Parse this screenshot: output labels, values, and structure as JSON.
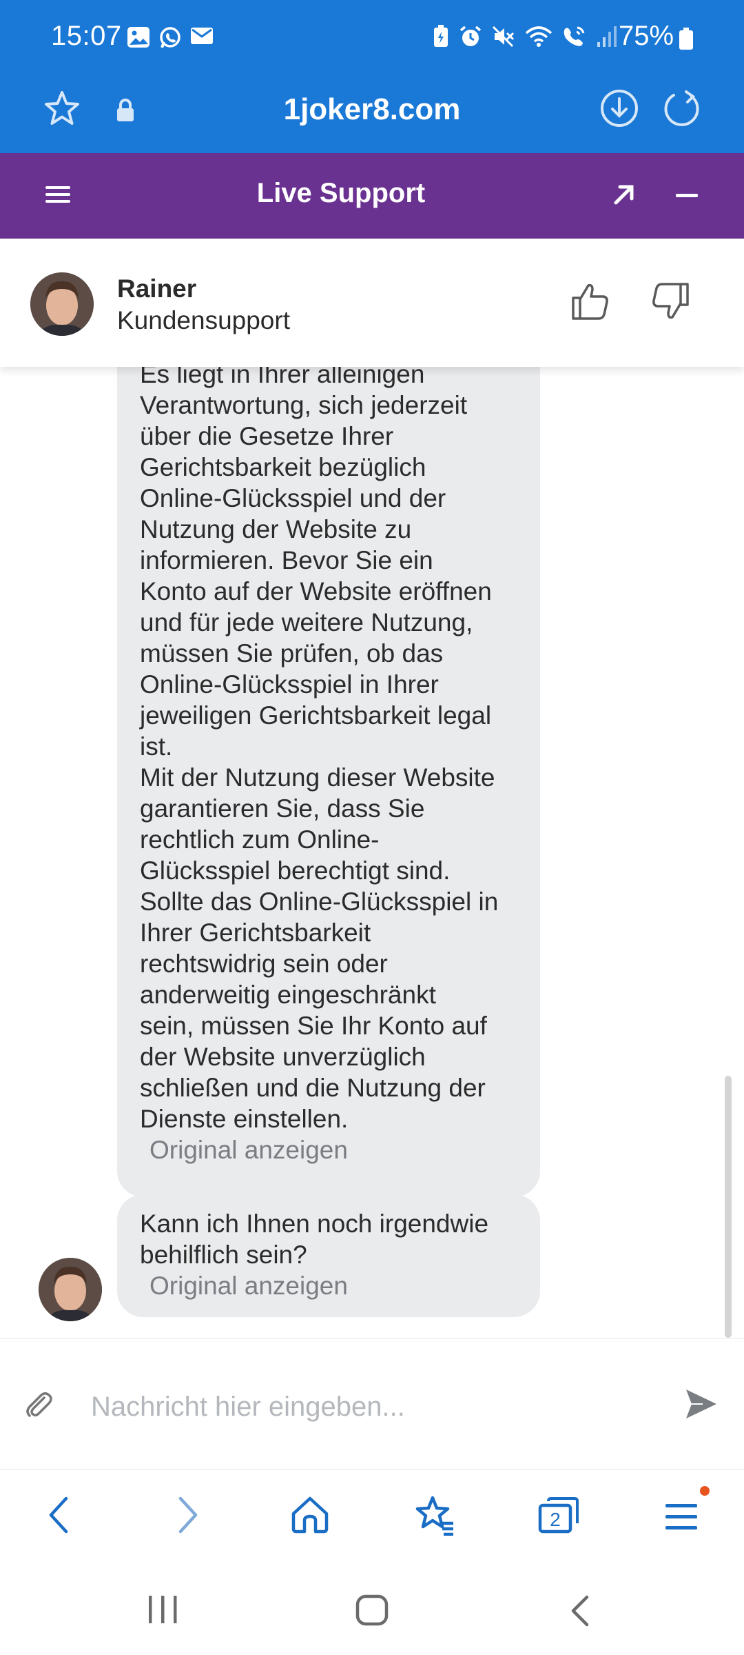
{
  "status_bar": {
    "time": "15:07",
    "battery": "75%",
    "left_icons": [
      "gallery-icon",
      "whatsapp-icon",
      "mail-icon"
    ],
    "right_icons": [
      "battery-saver-icon",
      "alarm-icon",
      "mute-icon",
      "wifi-icon",
      "wifi-call-icon",
      "signal-icon"
    ]
  },
  "browser": {
    "url": "1joker8.com"
  },
  "chat": {
    "header_title": "Live Support",
    "agent": {
      "name": "Rainer",
      "role": "Kundensupport"
    },
    "messages": [
      {
        "lines": [
          "Es liegt in Ihrer alleinigen",
          "Verantwortung, sich jederzeit",
          "über die Gesetze Ihrer",
          "Gerichtsbarkeit bezüglich",
          "Online-Glücksspiel und der",
          "Nutzung der Website zu",
          "informieren. Bevor Sie ein",
          "Konto auf der Website eröffnen",
          "und für jede weitere Nutzung,",
          "müssen Sie prüfen, ob das",
          "Online-Glücksspiel in Ihrer",
          "jeweiligen Gerichtsbarkeit legal",
          "ist.",
          "Mit der Nutzung dieser Website",
          "garantieren Sie, dass Sie",
          "rechtlich zum Online-",
          "Glücksspiel berechtigt sind.",
          "Sollte das Online-Glücksspiel in",
          "Ihrer Gerichtsbarkeit",
          "rechtswidrig sein oder",
          "anderweitig eingeschränkt",
          "sein, müssen Sie Ihr Konto auf",
          "der Website unverzüglich",
          "schließen und die Nutzung der",
          "Dienste einstellen."
        ],
        "original_link": "Original anzeigen"
      },
      {
        "lines": [
          "Kann ich Ihnen noch irgendwie",
          "behilflich sein?"
        ],
        "original_link": "Original anzeigen"
      }
    ],
    "input_placeholder": "Nachricht hier eingeben..."
  },
  "bottom_nav": {
    "tab_count": "2"
  },
  "colors": {
    "browser_blue": "#1a78d6",
    "chat_purple": "#6a3290",
    "bubble_gray": "#eaebed",
    "notification_dot": "#e8541e"
  }
}
